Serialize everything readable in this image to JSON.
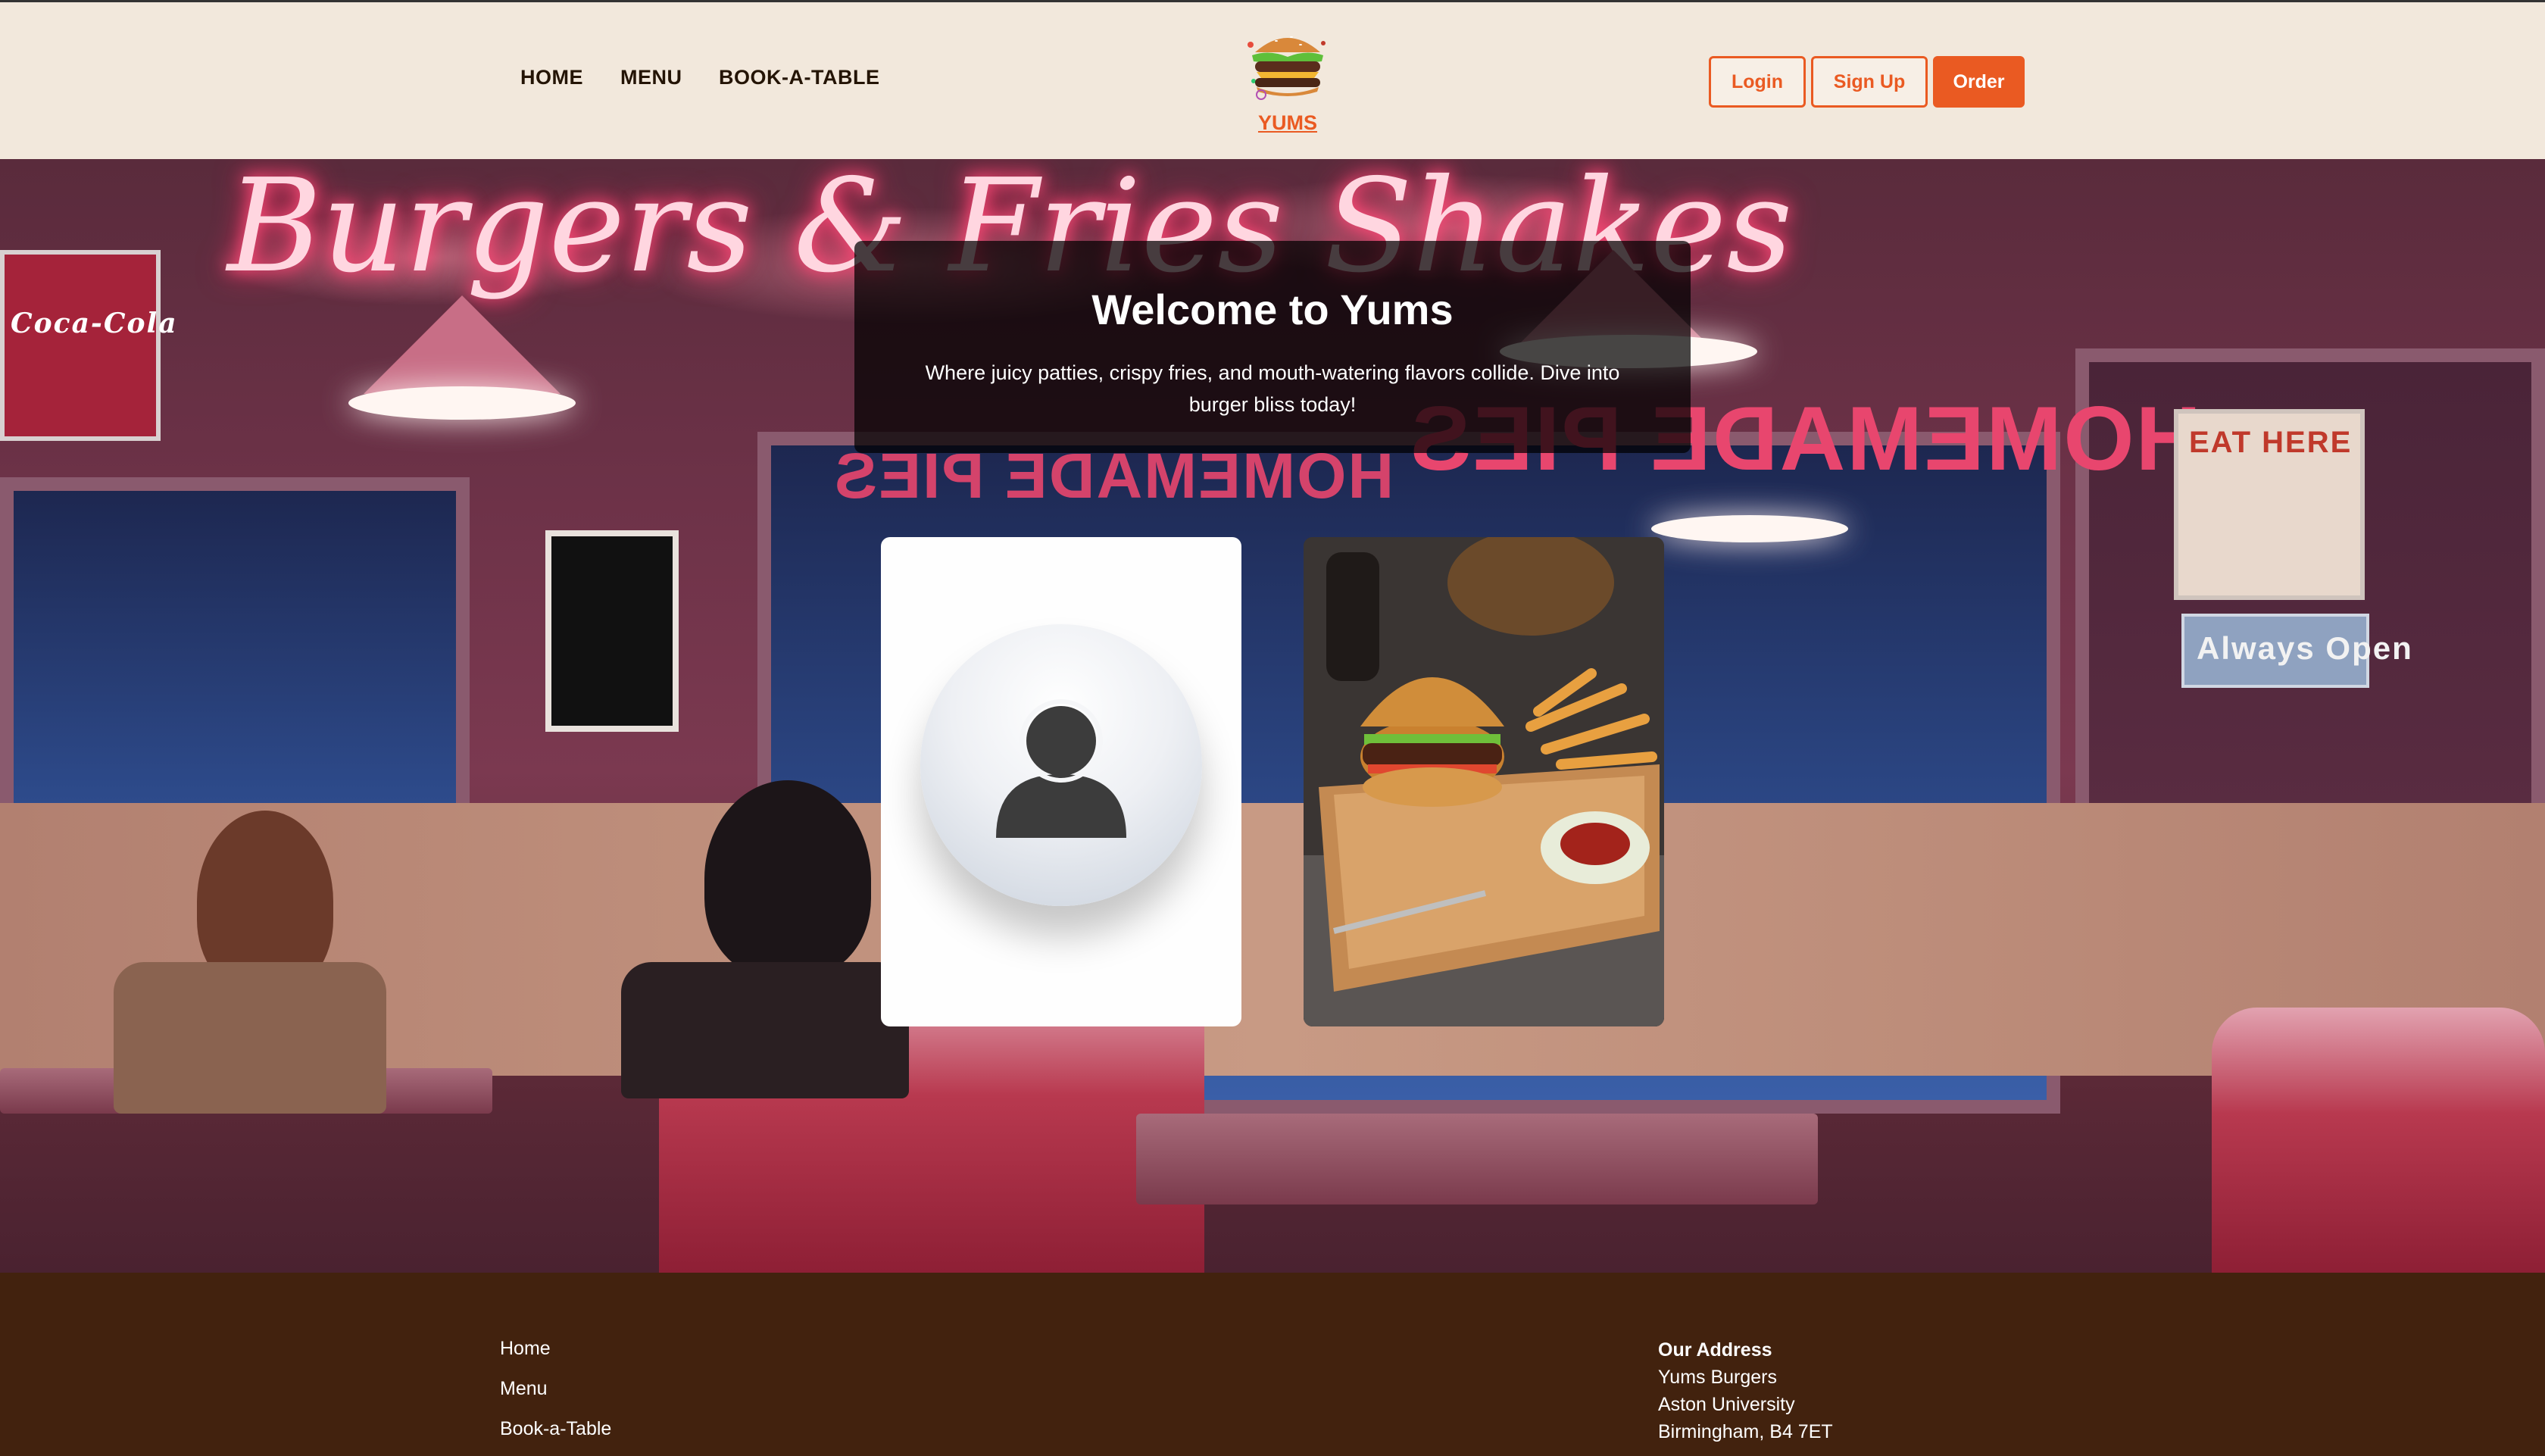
{
  "header": {
    "nav": [
      "HOME",
      "MENU",
      "BOOK-A-TABLE"
    ],
    "logo_text": "YUMS",
    "buttons": {
      "login": "Login",
      "signup": "Sign Up",
      "order": "Order"
    }
  },
  "hero": {
    "title": "Welcome to Yums",
    "subtitle": "Where juicy patties, crispy fries, and mouth-watering flavors collide. Dive into burger bliss today!",
    "background_signs": [
      "Burgers & Fries Shakes",
      "HOMEMADE PIES",
      "HOMEMADE PIES",
      "Coca-Cola",
      "EAT HERE",
      "Always Open"
    ]
  },
  "footer": {
    "links": [
      "Home",
      "Menu",
      "Book-a-Table"
    ],
    "address": {
      "title": "Our Address",
      "lines": [
        "Yums Burgers",
        "Aston University",
        "Birmingham, B4 7ET"
      ]
    }
  },
  "colors": {
    "accent": "#ea5a22",
    "header_bg": "#f2e8dc",
    "footer_bg": "#42220e"
  }
}
